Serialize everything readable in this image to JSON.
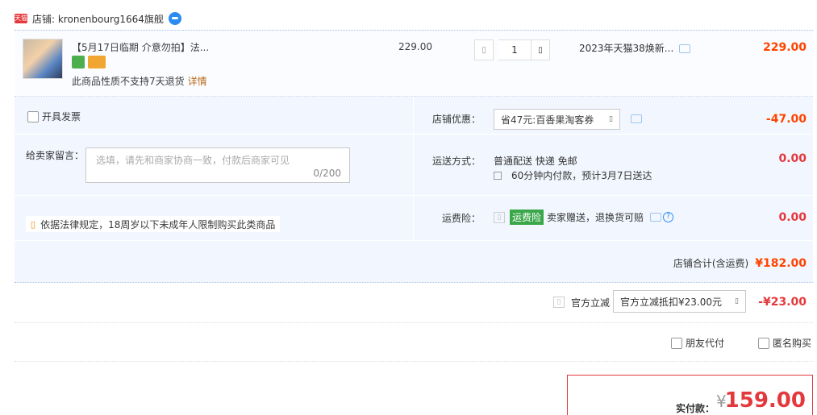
{
  "shop": {
    "badge": "天猫",
    "label": "店铺: kronenbourg1664旗舰"
  },
  "item": {
    "title": "【5月17日临期 介意勿拍】法...",
    "return_note": "此商品性质不支持7天退货",
    "detail_link": "详情",
    "unit_price": "229.00",
    "quantity": "1",
    "minus_glyph": "▯",
    "plus_glyph": "▯",
    "spec": "2023年天猫38焕新...",
    "subtotal": "229.00"
  },
  "invoice": {
    "label": "开具发票"
  },
  "message": {
    "label": "给卖家留言：",
    "placeholder": "选填，请先和商家协商一致，付款后商家可见",
    "count": "0/200"
  },
  "law_note": {
    "icon": "▯",
    "text": "依据法律规定，18周岁以下未成年人限制购买此类商品"
  },
  "promo": {
    "label": "店铺优惠：",
    "selected": "省47元:百香果淘客券",
    "chevron": "▯",
    "amount": "-47.00"
  },
  "shipping": {
    "label": "运送方式：",
    "method": "普通配送 快递 免邮",
    "eta": "60分钟内付款，预计3月7日送达",
    "amount": "0.00"
  },
  "insurance": {
    "label": "运费险：",
    "icon": "▯",
    "badge": "运费险",
    "text": "卖家赠送，退换货可赔",
    "help": "?",
    "amount": "0.00"
  },
  "shop_total": {
    "label": "店铺合计(含运费)",
    "value": "¥182.00"
  },
  "official": {
    "icon": "▯",
    "label": "官方立减",
    "selected": "官方立减抵扣¥23.00元",
    "chevron": "▯",
    "amount": "-¥23.00"
  },
  "options": {
    "friend_pay": "朋友代付",
    "anonymous": "匿名购买"
  },
  "payment": {
    "label": "实付款：",
    "yen": "¥",
    "amount": "159.00"
  }
}
